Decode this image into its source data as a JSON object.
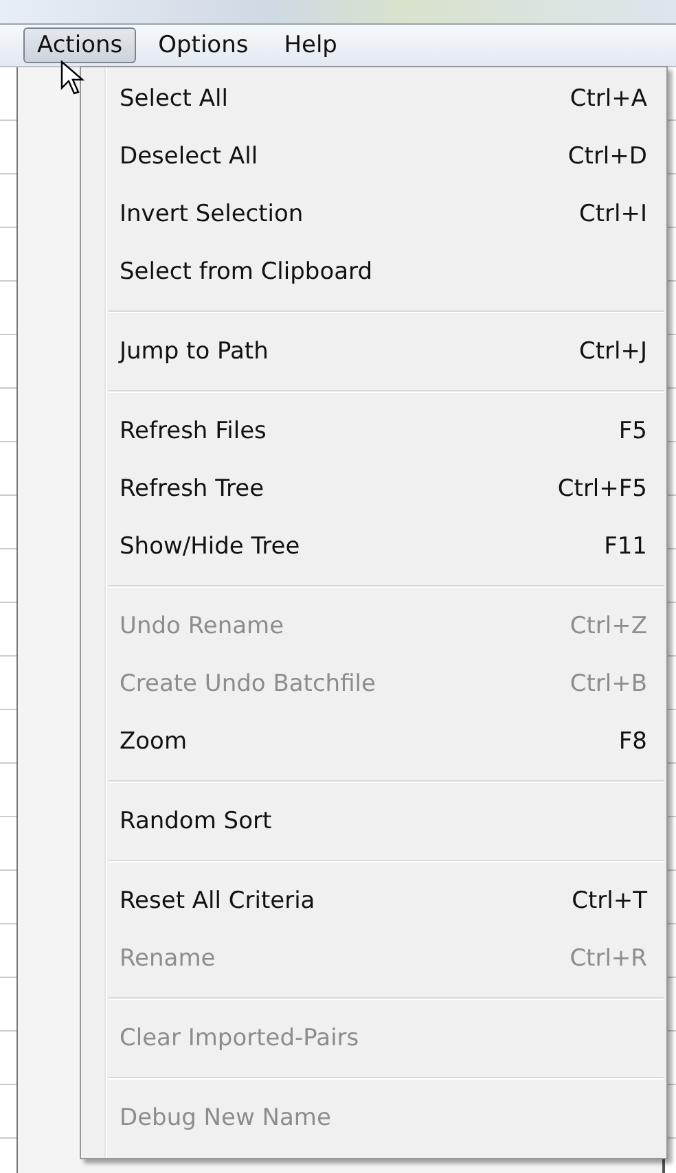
{
  "menu_bar": [
    {
      "label": "Actions",
      "selected": true
    },
    {
      "label": "Options",
      "selected": false
    },
    {
      "label": "Help",
      "selected": false
    }
  ],
  "menu": {
    "groups": [
      {
        "items": [
          {
            "label": "Select All",
            "shortcut": "Ctrl+A",
            "disabled": false
          },
          {
            "label": "Deselect All",
            "shortcut": "Ctrl+D",
            "disabled": false
          },
          {
            "label": "Invert Selection",
            "shortcut": "Ctrl+I",
            "disabled": false
          },
          {
            "label": "Select from Clipboard",
            "disabled": false
          }
        ]
      },
      {
        "items": [
          {
            "label": "Jump to Path",
            "shortcut": "Ctrl+J",
            "disabled": false
          }
        ]
      },
      {
        "items": [
          {
            "label": "Refresh Files",
            "shortcut": "F5",
            "disabled": false
          },
          {
            "label": "Refresh Tree",
            "shortcut": "Ctrl+F5",
            "disabled": false
          },
          {
            "label": "Show/Hide Tree",
            "shortcut": "F11",
            "disabled": false
          }
        ]
      },
      {
        "items": [
          {
            "label": "Undo Rename",
            "shortcut": "Ctrl+Z",
            "disabled": true
          },
          {
            "label": "Create Undo Batchfile",
            "shortcut": "Ctrl+B",
            "disabled": true
          },
          {
            "label": "Zoom",
            "shortcut": "F8",
            "disabled": false
          }
        ]
      },
      {
        "items": [
          {
            "label": "Random Sort",
            "disabled": false
          }
        ]
      },
      {
        "items": [
          {
            "label": "Reset All Criteria",
            "shortcut": "Ctrl+T",
            "disabled": false
          },
          {
            "label": "Rename",
            "shortcut": "Ctrl+R",
            "disabled": true
          }
        ]
      },
      {
        "items": [
          {
            "label": "Clear Imported-Pairs",
            "disabled": true
          }
        ]
      },
      {
        "items": [
          {
            "label": "Debug New Name",
            "disabled": true
          }
        ]
      }
    ]
  }
}
